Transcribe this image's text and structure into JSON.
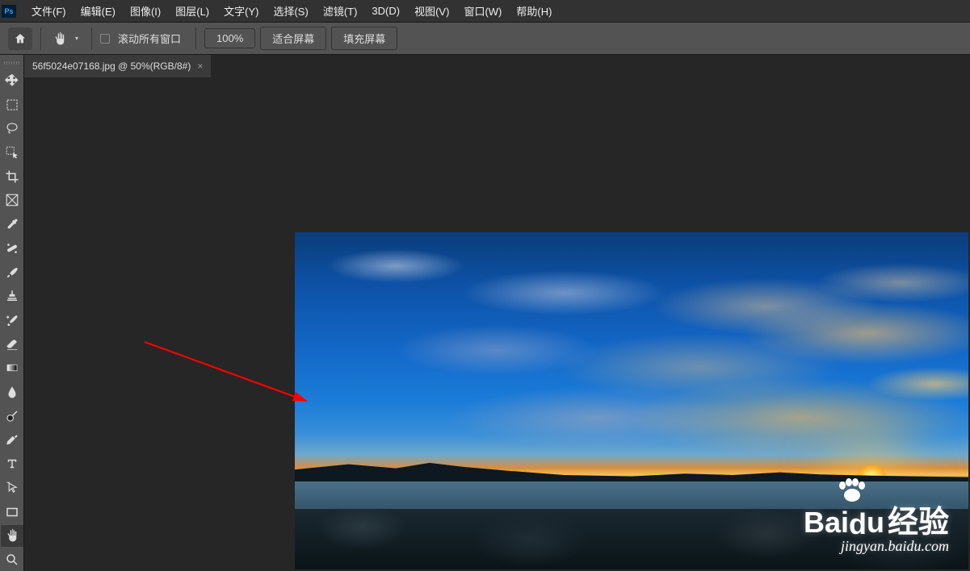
{
  "menubar": {
    "items": [
      {
        "label": "文件(F)"
      },
      {
        "label": "编辑(E)"
      },
      {
        "label": "图像(I)"
      },
      {
        "label": "图层(L)"
      },
      {
        "label": "文字(Y)"
      },
      {
        "label": "选择(S)"
      },
      {
        "label": "滤镜(T)"
      },
      {
        "label": "3D(D)"
      },
      {
        "label": "视图(V)"
      },
      {
        "label": "窗口(W)"
      },
      {
        "label": "帮助(H)"
      }
    ]
  },
  "options": {
    "scroll_all_label": "滚动所有窗口",
    "zoom_value": "100%",
    "fit_screen": "适合屏幕",
    "fill_screen": "填充屏幕"
  },
  "document": {
    "tab_title": "56f5024e07168.jpg @ 50%(RGB/8#)"
  },
  "watermark": {
    "brand": "Bai",
    "brand2": "du",
    "text": "经验",
    "url": "jingyan.baidu.com"
  }
}
